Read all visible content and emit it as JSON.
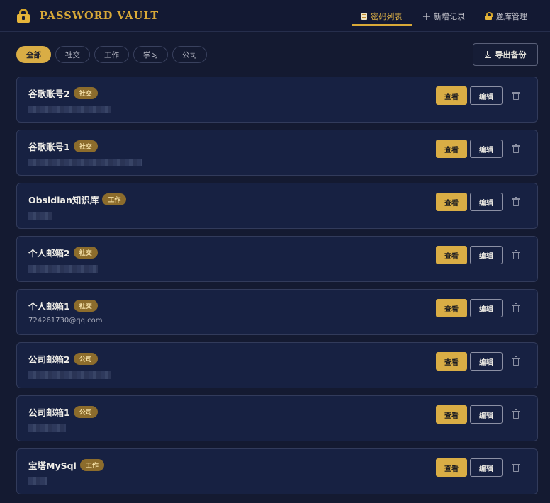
{
  "header": {
    "brand_title": "PASSWORD VAULT",
    "nav": [
      {
        "label": "密码列表",
        "icon": "document-icon",
        "active": true
      },
      {
        "label": "新增记录",
        "icon": "plus-icon",
        "active": false
      },
      {
        "label": "题库管理",
        "icon": "lock-icon",
        "active": false
      }
    ]
  },
  "filters": {
    "chips": [
      {
        "label": "全部",
        "active": true
      },
      {
        "label": "社交",
        "active": false
      },
      {
        "label": "工作",
        "active": false
      },
      {
        "label": "学习",
        "active": false
      },
      {
        "label": "公司",
        "active": false
      }
    ],
    "export_label": "导出备份"
  },
  "records": [
    {
      "title": "谷歌账号2",
      "tag": "社交",
      "subtitle": ""
    },
    {
      "title": "谷歌账号1",
      "tag": "社交",
      "subtitle": ""
    },
    {
      "title": "Obsidian知识库",
      "tag": "工作",
      "subtitle": ""
    },
    {
      "title": "个人邮箱2",
      "tag": "社交",
      "subtitle": ""
    },
    {
      "title": "个人邮箱1",
      "tag": "社交",
      "subtitle": "724261730@qq.com"
    },
    {
      "title": "公司邮箱2",
      "tag": "公司",
      "subtitle": ""
    },
    {
      "title": "公司邮箱1",
      "tag": "公司",
      "subtitle": ""
    },
    {
      "title": "宝塔MySql",
      "tag": "工作",
      "subtitle": ""
    }
  ],
  "actions": {
    "view_label": "查看",
    "edit_label": "编辑"
  },
  "colors": {
    "accent": "#d9ad45",
    "background": "#141a31",
    "card": "#172142",
    "tag_bg": "#8c6c2c"
  }
}
